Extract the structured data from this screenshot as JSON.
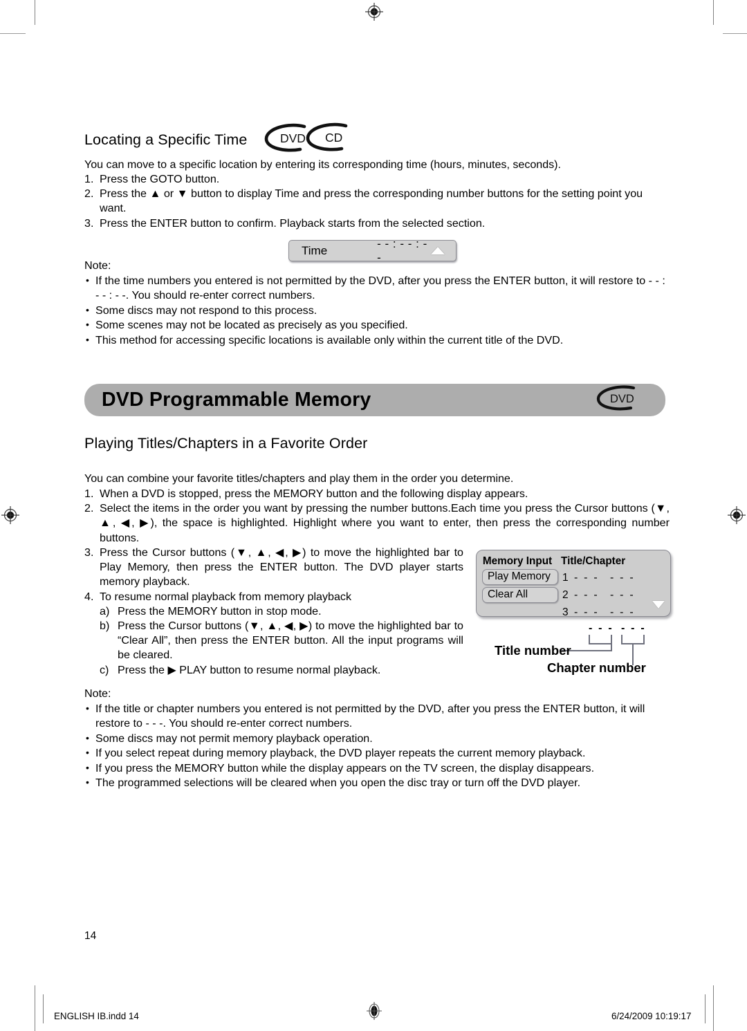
{
  "page": {
    "number": "14",
    "footer_left": "ENGLISH IB.indd   14",
    "footer_right": "6/24/2009   10:19:17"
  },
  "colors": {
    "banner_bg": "#adadad",
    "osd_bg": "#cdcdcd",
    "osd_border": "#8b8b93",
    "time_osd_bg": "#d2d2d2",
    "text": "#000000"
  },
  "section_time": {
    "heading": "Locating a Specific Time",
    "badges": [
      "DVD",
      "CD"
    ],
    "intro": "You can move to a specific location by entering its corresponding time (hours, minutes, seconds).",
    "steps": [
      {
        "marker": "1.",
        "text": "Press the GOTO button."
      },
      {
        "marker": "2.",
        "text": "Press the ▲ or ▼ button to display Time and press the corresponding number buttons for the setting point you want."
      },
      {
        "marker": "3.",
        "text": "Press the ENTER button to confirm. Playback starts from the selected section."
      }
    ],
    "osd": {
      "label": "Time",
      "value": "- - : - - : - -",
      "arrow_icon": "triangle-up-icon"
    },
    "note_label": "Note:",
    "notes": [
      "If the time numbers you entered is not permitted by the DVD, after you press the ENTER button, it will restore to - - : - - : - -. You should re-enter correct numbers.",
      "Some discs may not respond to this process.",
      "Some scenes may not be located as precisely as you specified.",
      "This method for accessing specific locations is available only within the current title of the DVD."
    ]
  },
  "section_memory": {
    "banner_title": "DVD Programmable Memory",
    "banner_badge": "DVD",
    "heading": "Playing Titles/Chapters in a Favorite Order",
    "intro": "You can combine your favorite titles/chapters and play them in the order you determine.",
    "steps": [
      {
        "marker": "1.",
        "text": "When a DVD is stopped, press the MEMORY button and the following display appears."
      },
      {
        "marker": "2.",
        "text": "Select the items in the order you want by pressing the number buttons.Each time you press the Cursor buttons (▼, ▲, ◀, ▶), the space is highlighted. Highlight where you want to enter, then press the corresponding number buttons."
      },
      {
        "marker": "3.",
        "text": "Press the Cursor buttons (▼, ▲, ◀, ▶) to move the highlighted bar to Play Memory, then press the ENTER button. The DVD player starts memory playback."
      },
      {
        "marker": "4.",
        "text": "To resume normal playback from memory playback"
      }
    ],
    "substeps": [
      {
        "marker": "a)",
        "text": "Press the MEMORY button in stop mode."
      },
      {
        "marker": "b)",
        "text": "Press the Cursor buttons (▼, ▲, ◀, ▶) to move the highlighted bar to “Clear All”, then press the ENTER button. All the input programs will be cleared."
      },
      {
        "marker": "c)",
        "text": "Press the ▶ PLAY button to resume normal playback."
      }
    ],
    "osd": {
      "col1_header": "Memory Input",
      "col2_header": "Title/Chapter",
      "buttons": [
        "Play Memory",
        "Clear All"
      ],
      "rows": [
        {
          "index": "1",
          "title": "- - -",
          "chapter": "- - -"
        },
        {
          "index": "2",
          "title": "- - -",
          "chapter": "- - -"
        },
        {
          "index": "3",
          "title": "- - -",
          "chapter": "- - -"
        }
      ],
      "scroll_icon": "triangle-down-icon"
    },
    "callouts": {
      "title_dashes": "- - -",
      "chapter_dashes": "- - -",
      "title_label": "Title number",
      "chapter_label": "Chapter number"
    },
    "note_label": "Note:",
    "notes": [
      "If the title or chapter numbers you entered is not permitted by the DVD, after you press the ENTER button, it will restore to - - -. You should re-enter correct numbers.",
      "Some discs may not permit memory playback operation.",
      "If you select repeat during memory playback, the DVD player repeats the current memory playback.",
      "If you press the MEMORY button while the display appears on the TV screen, the display disappears.",
      "The programmed selections will be cleared when you open the disc tray or turn off the DVD player."
    ]
  }
}
